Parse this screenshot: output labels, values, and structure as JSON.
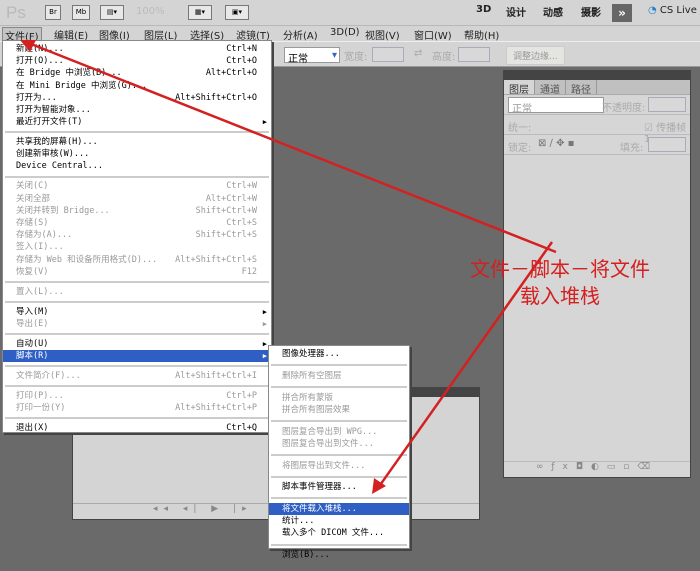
{
  "appbar": {
    "logo": "Ps",
    "br": "Br",
    "mb": "Mb",
    "zoom": "100%",
    "workspaces": [
      "3D",
      "设计",
      "动感",
      "摄影"
    ],
    "more": "»",
    "cslive": "CS Live"
  },
  "menubar": [
    "文件(F)",
    "编辑(E)",
    "图像(I)",
    "图层(L)",
    "选择(S)",
    "滤镜(T)",
    "分析(A)",
    "3D(D)",
    "视图(V)",
    "窗口(W)",
    "帮助(H)"
  ],
  "options": {
    "style_value": "正常",
    "width_label": "宽度:",
    "height_label": "高度:",
    "refine_edge": "调整边缘..."
  },
  "layers_panel": {
    "tabs": [
      "图层",
      "通道",
      "路径"
    ],
    "blend_mode": "正常",
    "opacity_label": "不透明度:",
    "unify_label": "统一:",
    "propagate_label": "传播帧 1",
    "lock_label": "锁定:",
    "fill_label": "填充:",
    "footer_icons": [
      "link-icon",
      "fx-icon",
      "mask-icon",
      "adjustment-icon",
      "group-icon",
      "new-layer-icon",
      "trash-icon"
    ]
  },
  "file_menu": [
    [
      {
        "label": "新建(N)...",
        "shortcut": "Ctrl+N"
      },
      {
        "label": "打开(O)...",
        "shortcut": "Ctrl+O"
      },
      {
        "label": "在 Bridge 中浏览(B)...",
        "shortcut": "Alt+Ctrl+O"
      },
      {
        "label": "在 Mini Bridge 中浏览(G)...",
        "shortcut": ""
      },
      {
        "label": "打开为...",
        "shortcut": "Alt+Shift+Ctrl+O"
      },
      {
        "label": "打开为智能对象...",
        "shortcut": ""
      },
      {
        "label": "最近打开文件(T)",
        "shortcut": "",
        "submenu": true
      }
    ],
    [
      {
        "label": "共享我的屏幕(H)...",
        "shortcut": ""
      },
      {
        "label": "创建新审核(W)...",
        "shortcut": ""
      },
      {
        "label": "Device Central...",
        "shortcut": ""
      }
    ],
    [
      {
        "label": "关闭(C)",
        "shortcut": "Ctrl+W",
        "disabled": true
      },
      {
        "label": "关闭全部",
        "shortcut": "Alt+Ctrl+W",
        "disabled": true
      },
      {
        "label": "关闭并转到 Bridge...",
        "shortcut": "Shift+Ctrl+W",
        "disabled": true
      },
      {
        "label": "存储(S)",
        "shortcut": "Ctrl+S",
        "disabled": true
      },
      {
        "label": "存储为(A)...",
        "shortcut": "Shift+Ctrl+S",
        "disabled": true
      },
      {
        "label": "签入(I)...",
        "shortcut": "",
        "disabled": true
      },
      {
        "label": "存储为 Web 和设备所用格式(D)...",
        "shortcut": "Alt+Shift+Ctrl+S",
        "disabled": true
      },
      {
        "label": "恢复(V)",
        "shortcut": "F12",
        "disabled": true
      }
    ],
    [
      {
        "label": "置入(L)...",
        "shortcut": "",
        "disabled": true
      }
    ],
    [
      {
        "label": "导入(M)",
        "shortcut": "",
        "submenu": true
      },
      {
        "label": "导出(E)",
        "shortcut": "",
        "submenu": true,
        "disabled": true
      }
    ],
    [
      {
        "label": "自动(U)",
        "shortcut": "",
        "submenu": true
      },
      {
        "label": "脚本(R)",
        "shortcut": "",
        "submenu": true,
        "highlighted": true
      }
    ],
    [
      {
        "label": "文件简介(F)...",
        "shortcut": "Alt+Shift+Ctrl+I",
        "disabled": true
      }
    ],
    [
      {
        "label": "打印(P)...",
        "shortcut": "Ctrl+P",
        "disabled": true
      },
      {
        "label": "打印一份(Y)",
        "shortcut": "Alt+Shift+Ctrl+P",
        "disabled": true
      }
    ],
    [
      {
        "label": "退出(X)",
        "shortcut": "Ctrl+Q"
      }
    ]
  ],
  "scripts_submenu": [
    [
      {
        "label": "图像处理器..."
      }
    ],
    [
      {
        "label": "删除所有空图层",
        "disabled": true
      }
    ],
    [
      {
        "label": "拼合所有蒙版",
        "disabled": true
      },
      {
        "label": "拼合所有图层效果",
        "disabled": true
      }
    ],
    [
      {
        "label": "图层复合导出到 WPG...",
        "disabled": true
      },
      {
        "label": "图层复合导出到文件...",
        "disabled": true
      }
    ],
    [
      {
        "label": "将图层导出到文件...",
        "disabled": true
      }
    ],
    [
      {
        "label": "脚本事件管理器..."
      }
    ],
    [
      {
        "label": "将文件载入堆栈...",
        "highlighted": true
      },
      {
        "label": "统计..."
      },
      {
        "label": "载入多个 DICOM 文件..."
      }
    ],
    [
      {
        "label": "浏览(B)..."
      }
    ]
  ],
  "annotation": {
    "line1": "文件－脚本－将文件",
    "line2": "载入堆栈",
    "color": "#d42020"
  }
}
